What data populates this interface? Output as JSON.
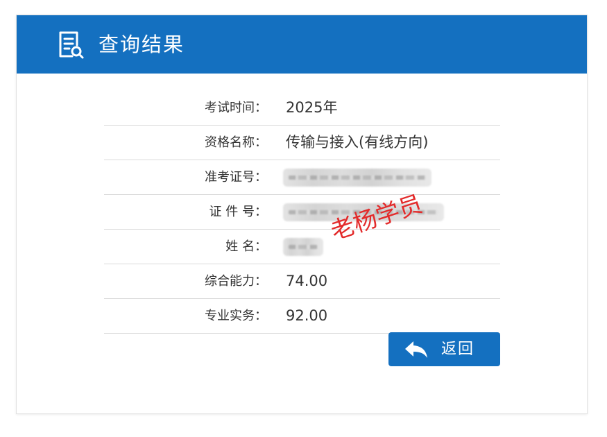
{
  "header": {
    "title": "查询结果",
    "icon": "document-search-icon",
    "background_color": "#1470c0"
  },
  "result": {
    "rows": [
      {
        "label": "考试时间：",
        "value": "2025年",
        "masked": false
      },
      {
        "label": "资格名称：",
        "value": "传输与接入(有线方向)",
        "masked": false
      },
      {
        "label": "准考证号：",
        "value": "",
        "masked": true
      },
      {
        "label": "证 件 号：",
        "value": "",
        "masked": true
      },
      {
        "label": "姓 名：",
        "value": "",
        "masked": true
      },
      {
        "label": "综合能力：",
        "value": "74.00",
        "masked": false
      },
      {
        "label": "专业实务：",
        "value": "92.00",
        "masked": false
      }
    ]
  },
  "watermark": {
    "text": "老杨学员",
    "color": "#e32b2b"
  },
  "actions": {
    "back_label": "返回",
    "back_icon": "reply-arrow-icon"
  }
}
